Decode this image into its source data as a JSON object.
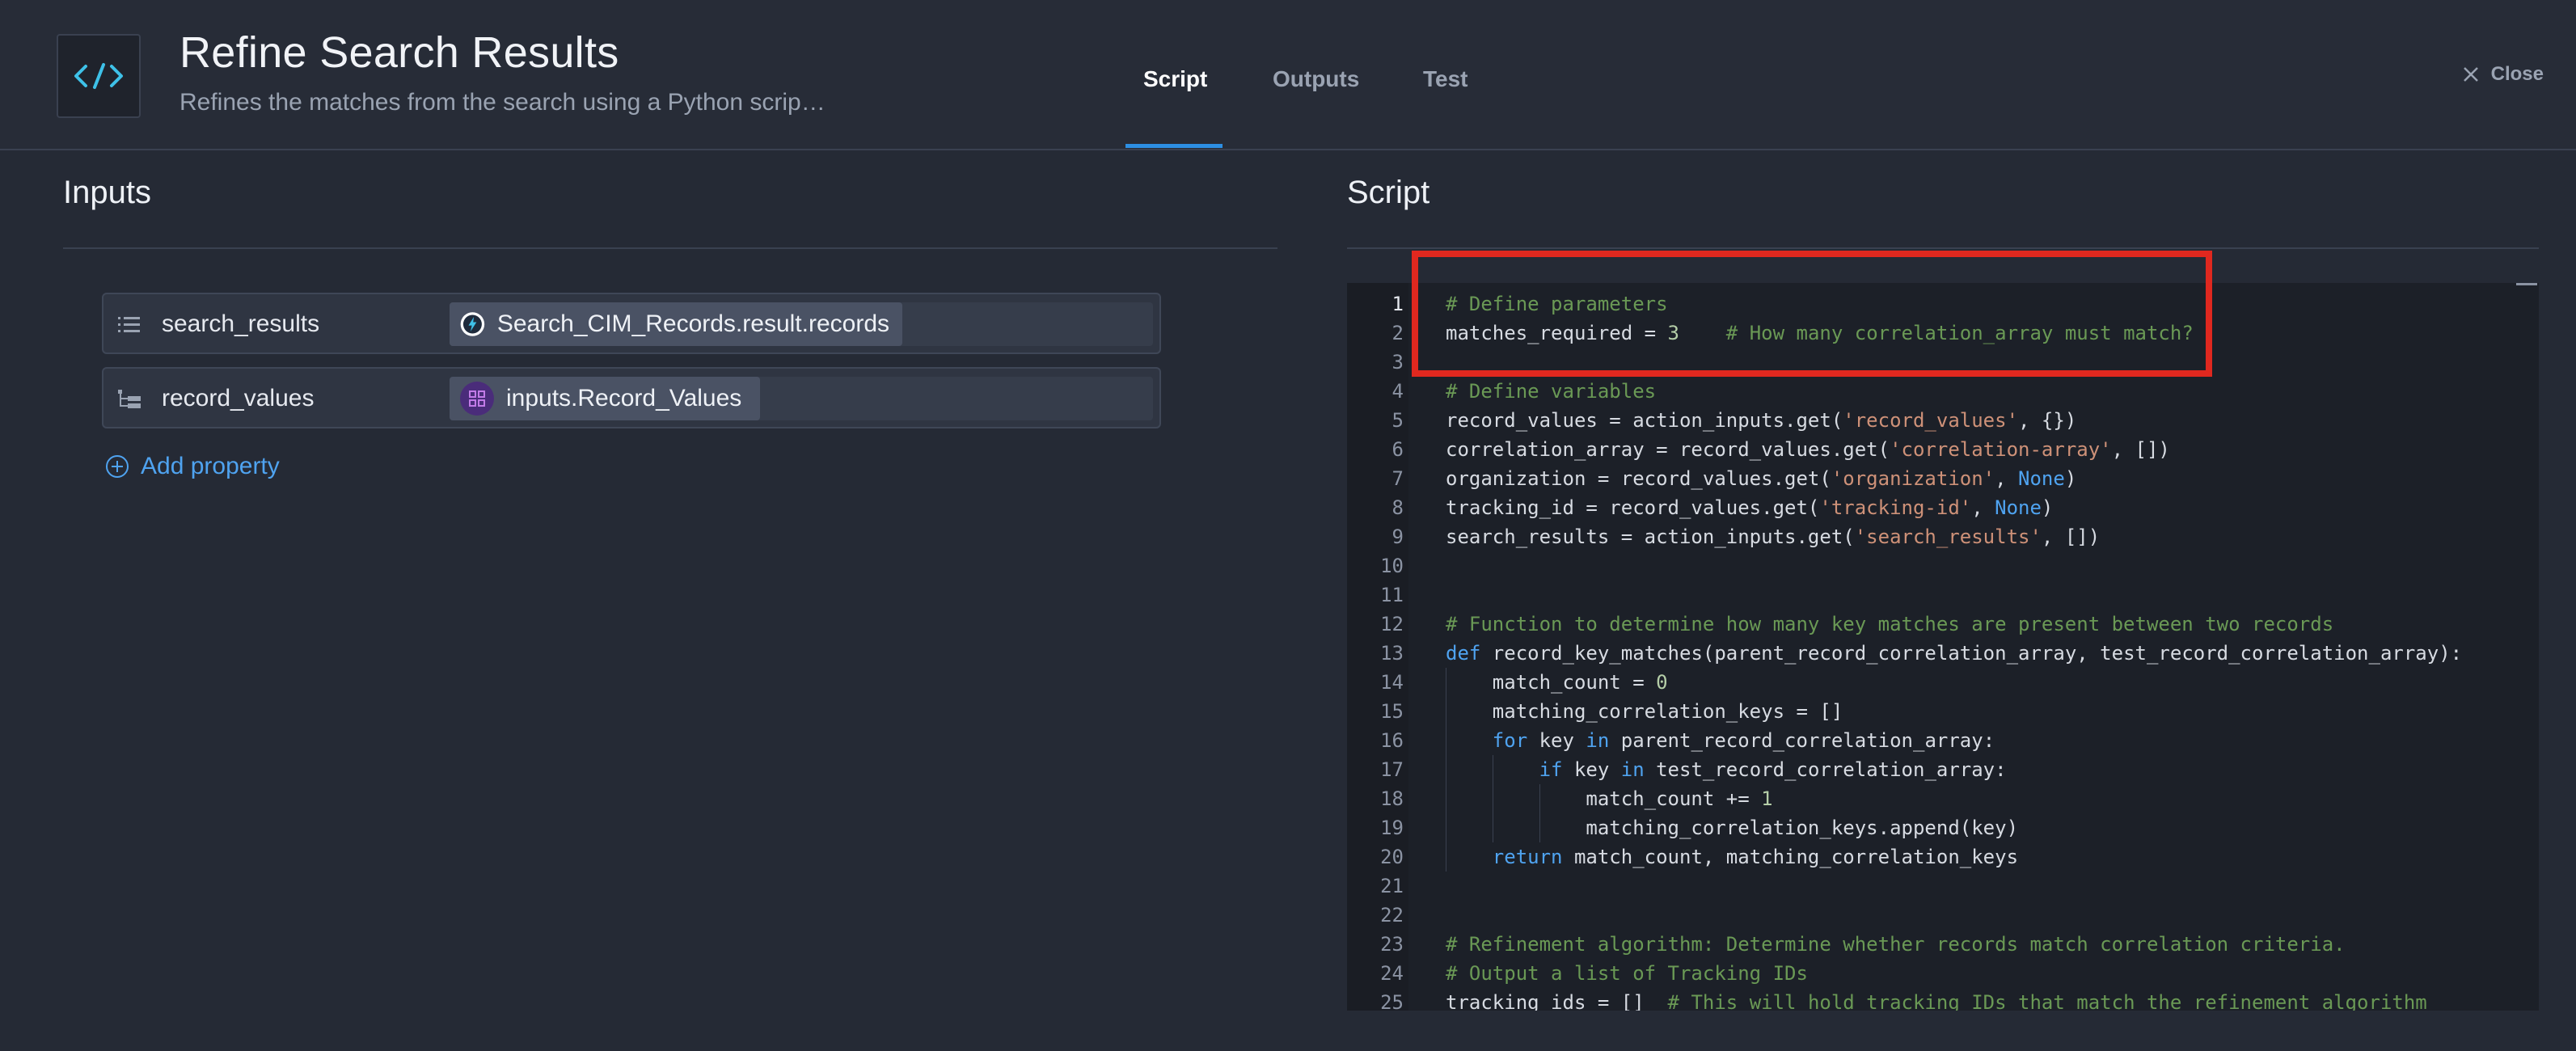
{
  "header": {
    "title": "Refine Search Results",
    "subtitle": "Refines the matches from the search using a Python scrip…",
    "app_icon": "code-icon",
    "tabs": [
      {
        "label": "Script",
        "active": true
      },
      {
        "label": "Outputs",
        "active": false
      },
      {
        "label": "Test",
        "active": false
      }
    ],
    "close_label": "Close"
  },
  "inputs": {
    "title": "Inputs",
    "rows": [
      {
        "label": "search_results",
        "icon": "list-icon",
        "value": "Search_CIM_Records.result.records",
        "value_icon": "splunk-app-icon"
      },
      {
        "label": "record_values",
        "icon": "tree-icon",
        "value": "inputs.Record_Values",
        "value_icon": "input-node-icon"
      }
    ],
    "add_property_label": "Add property"
  },
  "script": {
    "title": "Script",
    "lines": [
      {
        "n": "1",
        "tokens": [
          {
            "t": "# Define parameters",
            "c": "comment"
          }
        ]
      },
      {
        "n": "2",
        "tokens": [
          {
            "t": "matches_required = ",
            "c": ""
          },
          {
            "t": "3",
            "c": "num"
          },
          {
            "t": "    # How many correlation_array must match?",
            "c": "comment"
          }
        ]
      },
      {
        "n": "3",
        "tokens": []
      },
      {
        "n": "4",
        "tokens": [
          {
            "t": "# Define variables",
            "c": "comment"
          }
        ]
      },
      {
        "n": "5",
        "tokens": [
          {
            "t": "record_values = action_inputs.get(",
            "c": ""
          },
          {
            "t": "'record_values'",
            "c": "str"
          },
          {
            "t": ", {})",
            "c": ""
          }
        ]
      },
      {
        "n": "6",
        "tokens": [
          {
            "t": "correlation_array = record_values.get(",
            "c": ""
          },
          {
            "t": "'correlation-array'",
            "c": "str"
          },
          {
            "t": ", [])",
            "c": ""
          }
        ]
      },
      {
        "n": "7",
        "tokens": [
          {
            "t": "organization = record_values.get(",
            "c": ""
          },
          {
            "t": "'organization'",
            "c": "str"
          },
          {
            "t": ", ",
            "c": ""
          },
          {
            "t": "None",
            "c": "kw"
          },
          {
            "t": ")",
            "c": ""
          }
        ]
      },
      {
        "n": "8",
        "tokens": [
          {
            "t": "tracking_id = record_values.get(",
            "c": ""
          },
          {
            "t": "'tracking-id'",
            "c": "str"
          },
          {
            "t": ", ",
            "c": ""
          },
          {
            "t": "None",
            "c": "kw"
          },
          {
            "t": ")",
            "c": ""
          }
        ]
      },
      {
        "n": "9",
        "tokens": [
          {
            "t": "search_results = action_inputs.get(",
            "c": ""
          },
          {
            "t": "'search_results'",
            "c": "str"
          },
          {
            "t": ", [])",
            "c": ""
          }
        ]
      },
      {
        "n": "10",
        "tokens": []
      },
      {
        "n": "11",
        "tokens": []
      },
      {
        "n": "12",
        "tokens": [
          {
            "t": "# Function to determine how many key matches are present between two records",
            "c": "comment"
          }
        ]
      },
      {
        "n": "13",
        "tokens": [
          {
            "t": "def",
            "c": "kw"
          },
          {
            "t": " record_key_matches(parent_record_correlation_array, test_record_correlation_array):",
            "c": ""
          }
        ]
      },
      {
        "n": "14",
        "tokens": [
          {
            "t": "    match_count = ",
            "c": ""
          },
          {
            "t": "0",
            "c": "num"
          }
        ]
      },
      {
        "n": "15",
        "tokens": [
          {
            "t": "    matching_correlation_keys = []",
            "c": ""
          }
        ]
      },
      {
        "n": "16",
        "tokens": [
          {
            "t": "    ",
            "c": ""
          },
          {
            "t": "for",
            "c": "kw"
          },
          {
            "t": " key ",
            "c": ""
          },
          {
            "t": "in",
            "c": "kw"
          },
          {
            "t": " parent_record_correlation_array:",
            "c": ""
          }
        ]
      },
      {
        "n": "17",
        "tokens": [
          {
            "t": "        ",
            "c": ""
          },
          {
            "t": "if",
            "c": "kw"
          },
          {
            "t": " key ",
            "c": ""
          },
          {
            "t": "in",
            "c": "kw"
          },
          {
            "t": " test_record_correlation_array:",
            "c": ""
          }
        ]
      },
      {
        "n": "18",
        "tokens": [
          {
            "t": "            match_count += ",
            "c": ""
          },
          {
            "t": "1",
            "c": "num"
          }
        ]
      },
      {
        "n": "19",
        "tokens": [
          {
            "t": "            matching_correlation_keys.append(key)",
            "c": ""
          }
        ]
      },
      {
        "n": "20",
        "tokens": [
          {
            "t": "    ",
            "c": ""
          },
          {
            "t": "return",
            "c": "kw"
          },
          {
            "t": " match_count, matching_correlation_keys",
            "c": ""
          }
        ]
      },
      {
        "n": "21",
        "tokens": []
      },
      {
        "n": "22",
        "tokens": []
      },
      {
        "n": "23",
        "tokens": [
          {
            "t": "# Refinement algorithm: Determine whether records match correlation criteria.",
            "c": "comment"
          }
        ]
      },
      {
        "n": "24",
        "tokens": [
          {
            "t": "# Output a list of Tracking IDs",
            "c": "comment"
          }
        ]
      },
      {
        "n": "25",
        "tokens": [
          {
            "t": "tracking_ids = []  ",
            "c": ""
          },
          {
            "t": "# This will hold tracking IDs that match the refinement algorithm",
            "c": "comment"
          }
        ]
      }
    ]
  },
  "colors": {
    "accent": "#2d8fe3",
    "annotation_box": "#e0281f"
  }
}
